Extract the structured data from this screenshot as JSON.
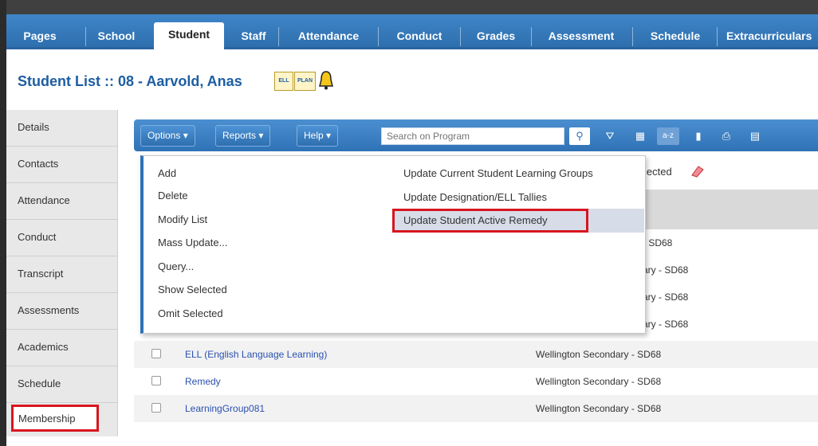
{
  "nav": {
    "tabs": [
      {
        "label": "Pages"
      },
      {
        "label": "School"
      },
      {
        "label": "Student"
      },
      {
        "label": "Staff"
      },
      {
        "label": "Attendance"
      },
      {
        "label": "Conduct"
      },
      {
        "label": "Grades"
      },
      {
        "label": "Assessment"
      },
      {
        "label": "Schedule"
      },
      {
        "label": "Extracurriculars"
      }
    ],
    "active": "Student"
  },
  "page": {
    "title": "Student List :: 08 - Aarvold, Anas",
    "badges": [
      "ELL",
      "PLAN"
    ]
  },
  "sidebar": {
    "items": [
      {
        "label": "Details"
      },
      {
        "label": "Contacts"
      },
      {
        "label": "Attendance"
      },
      {
        "label": "Conduct"
      },
      {
        "label": "Transcript"
      },
      {
        "label": "Assessments"
      },
      {
        "label": "Academics"
      },
      {
        "label": "Schedule"
      },
      {
        "label": "Membership"
      }
    ]
  },
  "toolbar": {
    "options_label": "Options ▾",
    "reports_label": "Reports ▾",
    "help_label": "Help ▾",
    "search_placeholder": "Search on Program",
    "icons": [
      "search-icon",
      "filter-icon",
      "grid-icon",
      "sort-az-icon",
      "chart-icon",
      "print-icon",
      "book-icon"
    ]
  },
  "options_menu": {
    "left": [
      {
        "label": "Add"
      },
      {
        "label": "Delete"
      },
      {
        "label": "Modify List"
      },
      {
        "label": "Mass Update..."
      },
      {
        "label": "Query..."
      },
      {
        "label": "Show Selected"
      },
      {
        "label": "Omit Selected"
      }
    ],
    "right": [
      {
        "label": "Update Current Student Learning Groups"
      },
      {
        "label": "Update Designation/ELL Tallies"
      },
      {
        "label": "Update Student Active Remedy"
      }
    ],
    "highlighted": "Update Student Active Remedy"
  },
  "selection": {
    "text": "lected"
  },
  "partial_rows": [
    "- SD68",
    "ary - SD68",
    "ary - SD68",
    "ary - SD68"
  ],
  "rows": [
    {
      "name": "ELL (English Language Learning)",
      "school": "Wellington Secondary - SD68"
    },
    {
      "name": "Remedy",
      "school": "Wellington Secondary - SD68"
    },
    {
      "name": "LearningGroup081",
      "school": "Wellington Secondary - SD68"
    }
  ],
  "colors": {
    "accent": "#2f72b6",
    "highlight_box": "#d8151f",
    "title": "#1d5ea3"
  }
}
